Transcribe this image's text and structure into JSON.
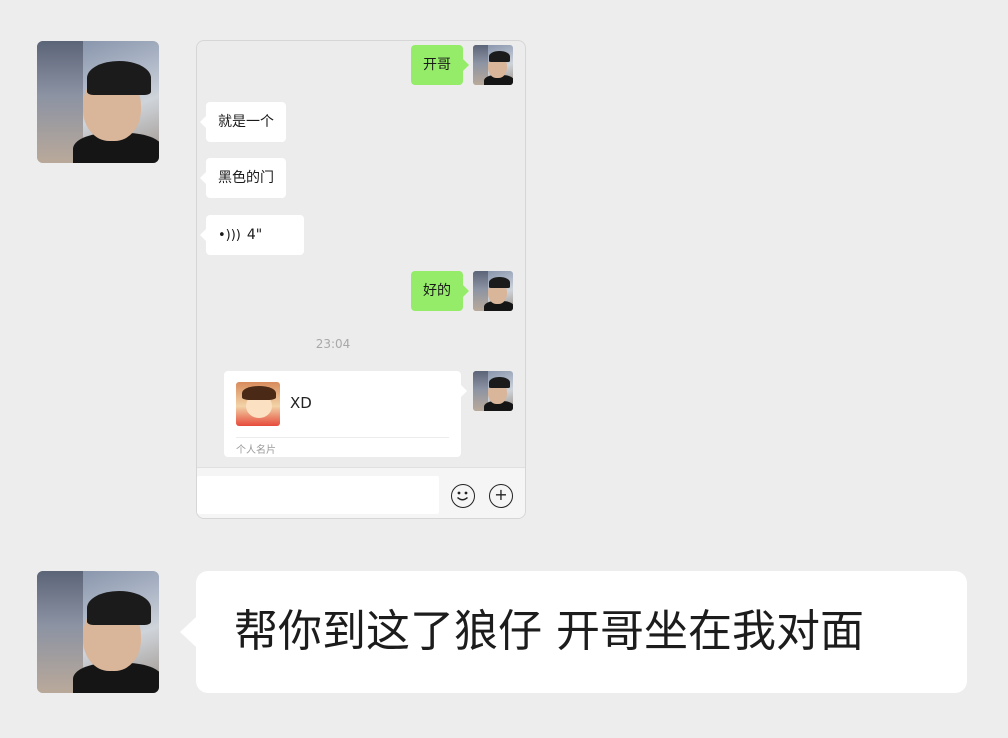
{
  "card": {
    "messages": [
      {
        "from": "me",
        "text": "开哥"
      },
      {
        "from": "other",
        "text": "就是一个"
      },
      {
        "from": "other",
        "text": "黑色的门"
      },
      {
        "from": "other",
        "voice": "4\""
      },
      {
        "from": "me",
        "text": "好的"
      }
    ],
    "time": "23:04",
    "contact_card": {
      "name": "XD",
      "label": "个人名片"
    }
  },
  "input_bar": {
    "emoji_icon": "emoji-icon",
    "plus_icon": "plus-icon",
    "plus_glyph": "+"
  },
  "big_message": "帮你到这了狼仔 开哥坐在我对面",
  "colors": {
    "background": "#ededed",
    "my_bubble": "#95ec69",
    "other_bubble": "#ffffff"
  }
}
